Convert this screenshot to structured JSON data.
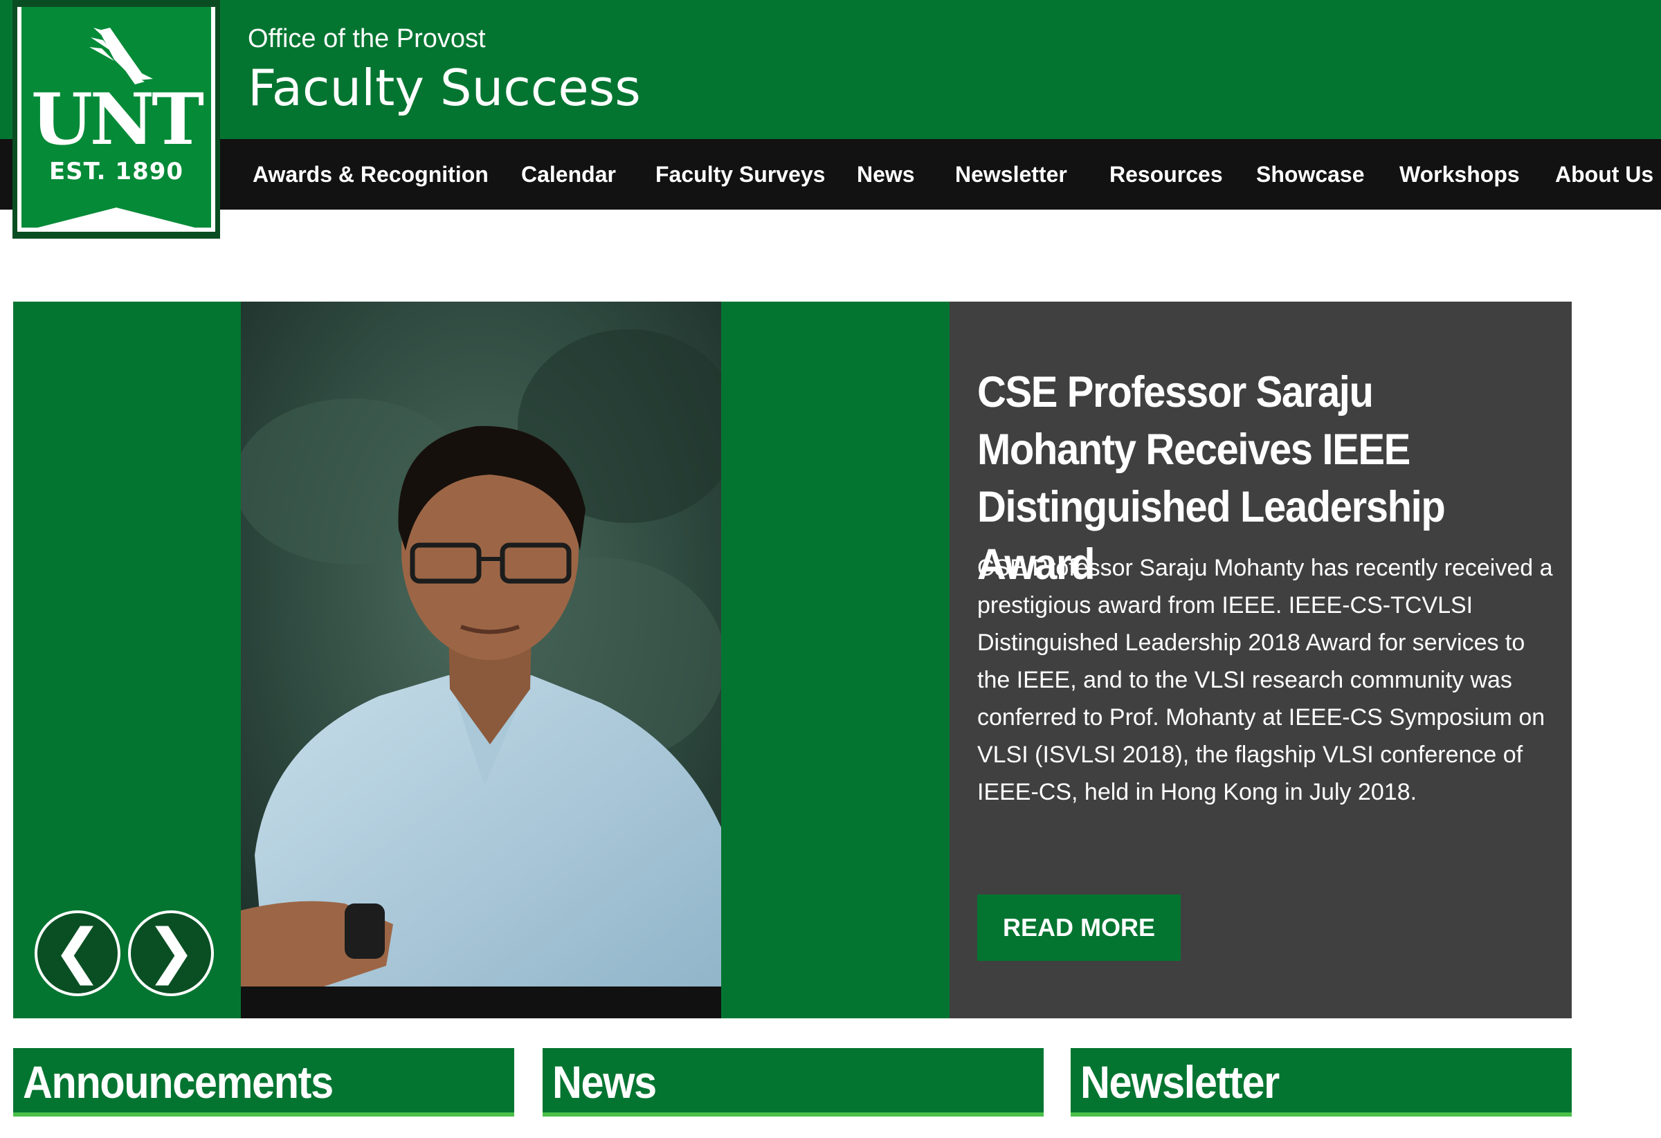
{
  "colors": {
    "unt_green": "#047531",
    "nav_black": "#121212",
    "story_gray": "#404040",
    "accent_light_green": "#4cc04a"
  },
  "logo": {
    "wordmark": "UNT",
    "established": "EST. 1890",
    "icon": "eagle-icon"
  },
  "header": {
    "office": "Office of the Provost",
    "title": "Faculty Success"
  },
  "nav": {
    "items": [
      {
        "label": "Awards & Recognition"
      },
      {
        "label": "Calendar"
      },
      {
        "label": "Faculty Surveys"
      },
      {
        "label": "News"
      },
      {
        "label": "Newsletter"
      },
      {
        "label": "Resources"
      },
      {
        "label": "Showcase"
      },
      {
        "label": "Workshops"
      },
      {
        "label": "About Us"
      }
    ]
  },
  "hero": {
    "title": "CSE Professor Saraju Mohanty Receives IEEE Distinguished Leadership Award",
    "body": "CSE Professor Saraju Mohanty has recently received a prestigious award from IEEE. IEEE-CS-TCVLSI Distinguished Leadership 2018 Award for services to the IEEE, and to the VLSI research community was conferred to Prof. Mohanty at IEEE-CS Symposium on VLSI (ISVLSI 2018), the flagship VLSI conference of IEEE-CS, held in Hong Kong in July 2018.",
    "button_label": "READ MORE",
    "prev_glyph": "❮",
    "next_glyph": "❯"
  },
  "sections": {
    "announcements": "Announcements",
    "news": "News",
    "newsletter": "Newsletter"
  }
}
